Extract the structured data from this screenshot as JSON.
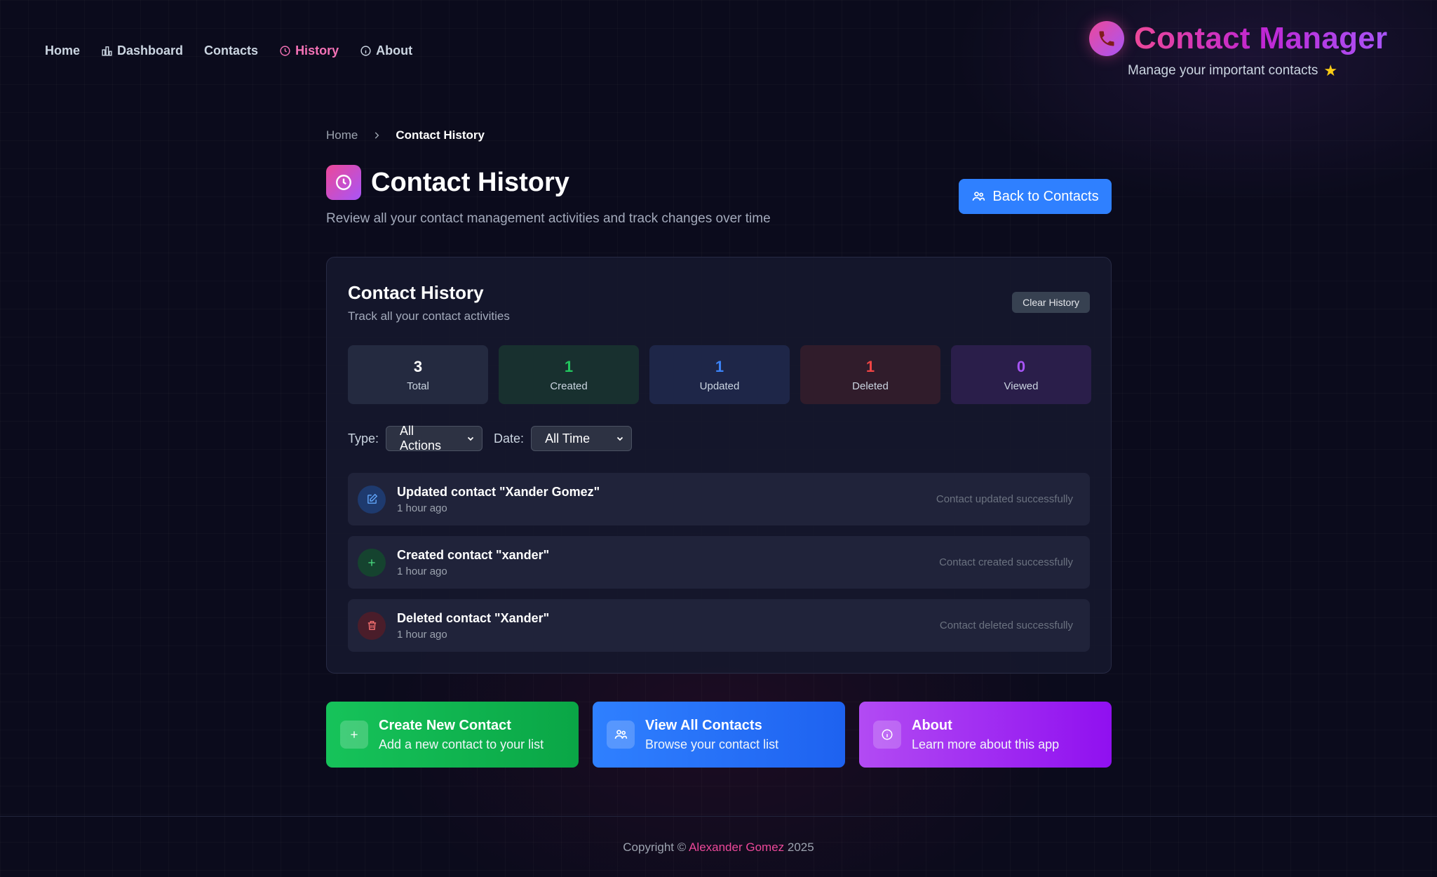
{
  "nav": {
    "home": "Home",
    "dashboard": "Dashboard",
    "contacts": "Contacts",
    "history": "History",
    "about": "About"
  },
  "brand": {
    "title": "Contact Manager",
    "subtitle": "Manage your important contacts",
    "star": "★"
  },
  "breadcrumb": {
    "home": "Home",
    "current": "Contact History"
  },
  "page": {
    "title": "Contact History",
    "subtitle": "Review all your contact management activities and track changes over time",
    "back_label": "Back to Contacts"
  },
  "card": {
    "title": "Contact History",
    "subtitle": "Track all your contact activities",
    "clear_label": "Clear History"
  },
  "stats": [
    {
      "value": "3",
      "label": "Total",
      "color": "#ffffff",
      "bg": "#242a40"
    },
    {
      "value": "1",
      "label": "Created",
      "color": "#22c55e",
      "bg": "#18302f"
    },
    {
      "value": "1",
      "label": "Updated",
      "color": "#3b82f6",
      "bg": "#1e2648"
    },
    {
      "value": "1",
      "label": "Deleted",
      "color": "#ef4444",
      "bg": "#301c2b"
    },
    {
      "value": "0",
      "label": "Viewed",
      "color": "#a855f7",
      "bg": "#2a1e4a"
    }
  ],
  "filters": {
    "type_label": "Type:",
    "type_value": "All Actions",
    "date_label": "Date:",
    "date_value": "All Time"
  },
  "history": [
    {
      "title": "Updated contact \"Xander Gomez\"",
      "time": "1 hour ago",
      "message": "Contact updated successfully",
      "icon": "edit-icon"
    },
    {
      "title": "Created contact \"xander\"",
      "time": "1 hour ago",
      "message": "Contact created successfully",
      "icon": "plus-icon"
    },
    {
      "title": "Deleted contact \"Xander\"",
      "time": "1 hour ago",
      "message": "Contact deleted successfully",
      "icon": "trash-icon"
    }
  ],
  "actions": [
    {
      "title": "Create New Contact",
      "subtitle": "Add a new contact to your list"
    },
    {
      "title": "View All Contacts",
      "subtitle": "Browse your contact list"
    },
    {
      "title": "About",
      "subtitle": "Learn more about this app"
    }
  ],
  "footer": {
    "prefix": "Copyright ©",
    "author": "Alexander Gomez",
    "year": "2025"
  },
  "colors": {
    "accent": "#ec4899",
    "primary": "#2f80ff",
    "purple": "#a855f7"
  }
}
